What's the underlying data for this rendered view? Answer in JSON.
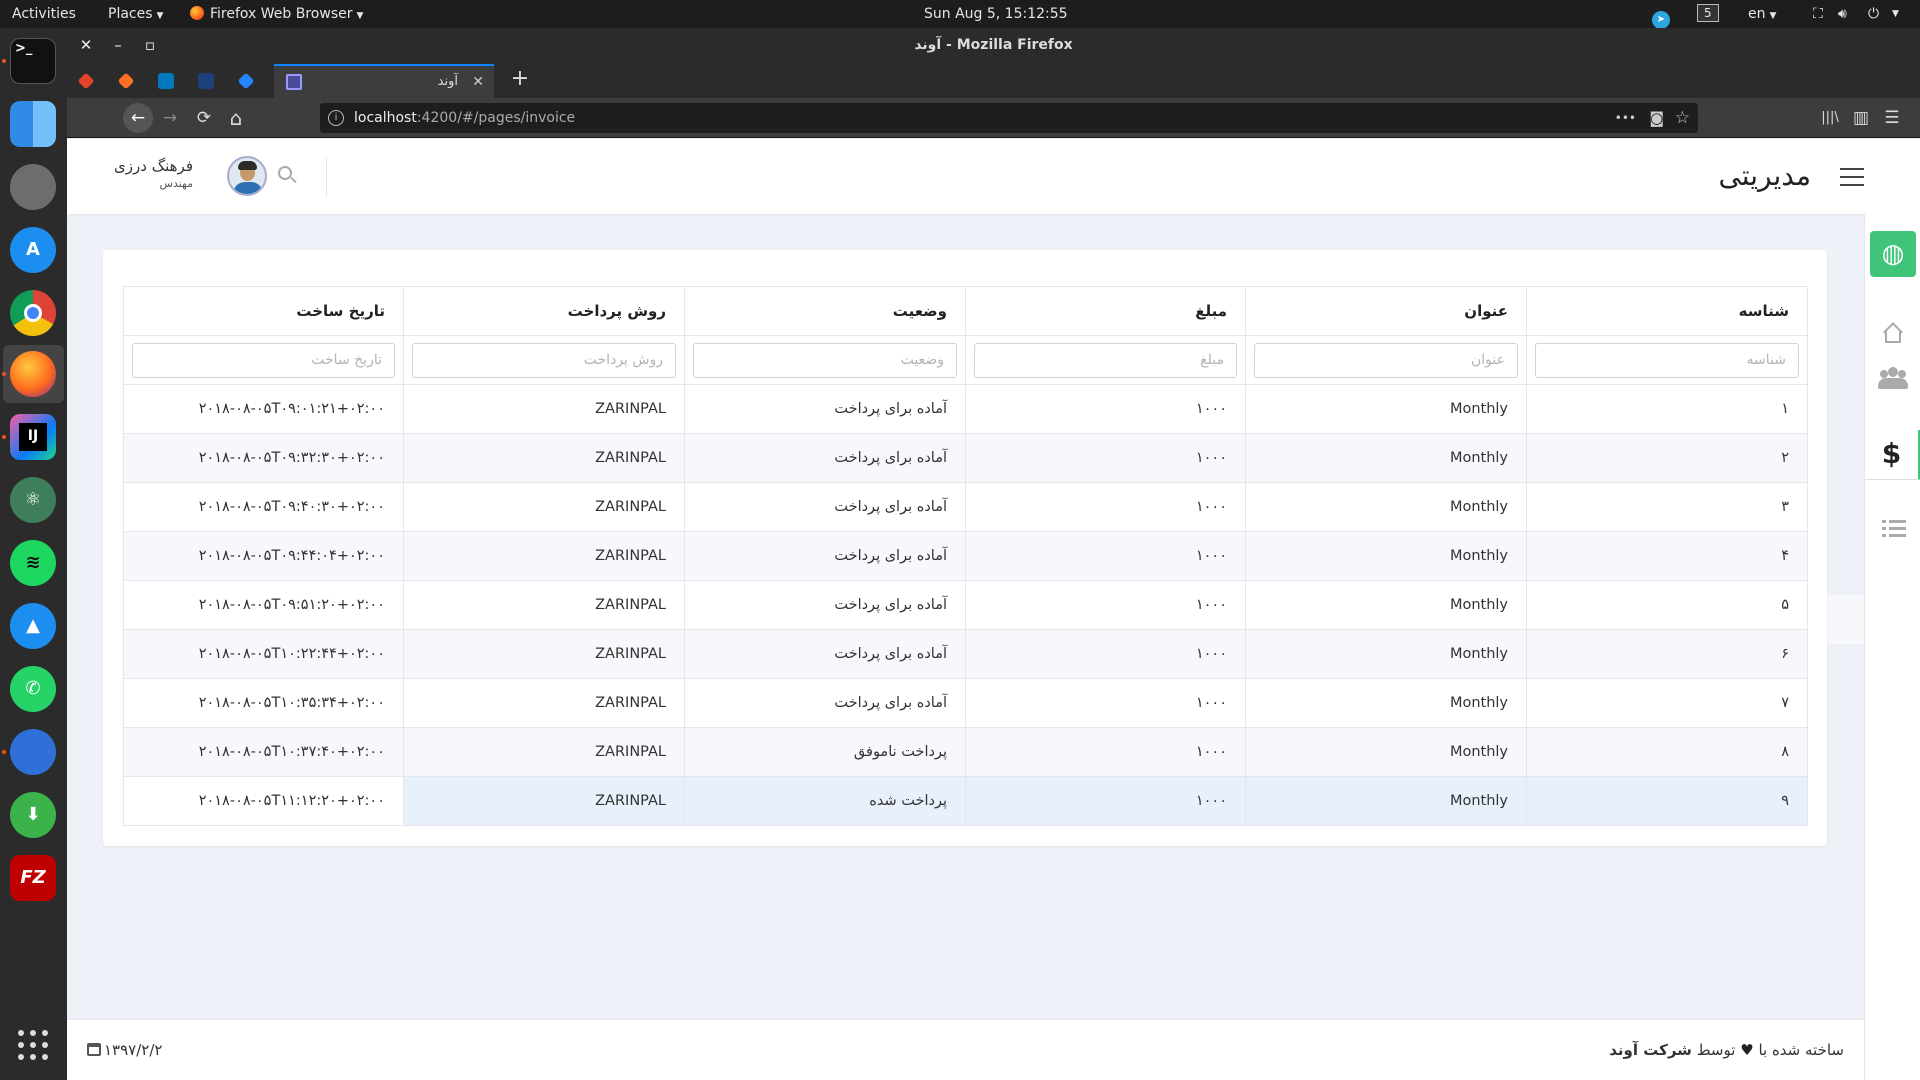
{
  "system_bar": {
    "activities": "Activities",
    "places": "Places",
    "app_name": "Firefox Web Browser",
    "clock": "Sun Aug  5, 15:12:55",
    "workspace": "5",
    "lang": "en"
  },
  "dock": {
    "apps": [
      "terminal-icon",
      "finder-icon",
      "settings-icon",
      "app-store-icon",
      "chrome-icon",
      "firefox-icon",
      "intellij-icon",
      "atom-icon",
      "spotify-icon",
      "navigation-icon",
      "whatsapp-icon",
      "eagle-icon",
      "download-icon",
      "filezilla-icon"
    ],
    "terminal_label": ">_",
    "intellij_label": "IJ",
    "filezilla_label": "FZ"
  },
  "browser": {
    "window_title": "آوند - Mozilla Firefox",
    "window_buttons": {
      "close": "✕",
      "minimize": "–",
      "maximize": "▫"
    },
    "active_tab_title": "آوند",
    "tab_close": "✕",
    "new_tab": "+",
    "url_host": "localhost",
    "url_rest": ":4200/#/pages/invoice",
    "nav": {
      "back": "←",
      "forward": "→",
      "reload": "⟳",
      "home": "⌂"
    },
    "url_actions": {
      "more": "•••",
      "pocket": "◙",
      "bookmark": "☆"
    },
    "toolbar_right": {
      "library": "|||\\",
      "sidebar": "▥",
      "menu": "☰"
    }
  },
  "header": {
    "brand": "مدیریتی",
    "user_name": "فرهنگ درزی",
    "user_role": "مهندس"
  },
  "table": {
    "columns": [
      "شناسه",
      "عنوان",
      "مبلغ",
      "وضعیت",
      "روش پرداخت",
      "تاریخ ساخت"
    ],
    "filters": [
      "شناسه",
      "عنوان",
      "مبلغ",
      "وضعیت",
      "روش پرداخت",
      "تاریخ ساخت"
    ],
    "rows": [
      [
        "۱",
        "Monthly",
        "۱۰۰۰",
        "آماده برای پرداخت",
        "ZARINPAL",
        "۲۰۱۸-۰۸-۰۵T۰۹:۰۱:۲۱+۰۲:۰۰"
      ],
      [
        "۲",
        "Monthly",
        "۱۰۰۰",
        "آماده برای پرداخت",
        "ZARINPAL",
        "۲۰۱۸-۰۸-۰۵T۰۹:۳۲:۳۰+۰۲:۰۰"
      ],
      [
        "۳",
        "Monthly",
        "۱۰۰۰",
        "آماده برای پرداخت",
        "ZARINPAL",
        "۲۰۱۸-۰۸-۰۵T۰۹:۴۰:۳۰+۰۲:۰۰"
      ],
      [
        "۴",
        "Monthly",
        "۱۰۰۰",
        "آماده برای پرداخت",
        "ZARINPAL",
        "۲۰۱۸-۰۸-۰۵T۰۹:۴۴:۰۴+۰۲:۰۰"
      ],
      [
        "۵",
        "Monthly",
        "۱۰۰۰",
        "آماده برای پرداخت",
        "ZARINPAL",
        "۲۰۱۸-۰۸-۰۵T۰۹:۵۱:۲۰+۰۲:۰۰"
      ],
      [
        "۶",
        "Monthly",
        "۱۰۰۰",
        "آماده برای پرداخت",
        "ZARINPAL",
        "۲۰۱۸-۰۸-۰۵T۱۰:۲۲:۴۴+۰۲:۰۰"
      ],
      [
        "۷",
        "Monthly",
        "۱۰۰۰",
        "آماده برای پرداخت",
        "ZARINPAL",
        "۲۰۱۸-۰۸-۰۵T۱۰:۳۵:۳۴+۰۲:۰۰"
      ],
      [
        "۸",
        "Monthly",
        "۱۰۰۰",
        "پرداخت ناموفق",
        "ZARINPAL",
        "۲۰۱۸-۰۸-۰۵T۱۰:۳۷:۴۰+۰۲:۰۰"
      ],
      [
        "۹",
        "Monthly",
        "۱۰۰۰",
        "پرداخت شده",
        "ZARINPAL",
        "۲۰۱۸-۰۸-۰۵T۱۱:۱۲:۲۰+۰۲:۰۰"
      ]
    ]
  },
  "rail": {
    "icons": [
      "globe-icon",
      "home-icon",
      "users-icon",
      "dollar-icon",
      "list-icon"
    ],
    "dollar": "$",
    "globe": "◍"
  },
  "footer": {
    "credit_prefix": "ساخته شده با",
    "heart": "♥",
    "credit_mid": "توسط",
    "company": "شرکت آوند",
    "date": "۱۳۹۷/۲/۲"
  },
  "colors": {
    "accent_green": "#3fc47a",
    "selected_row": "#e8f1fb",
    "tab_accent": "#0a84ff"
  }
}
